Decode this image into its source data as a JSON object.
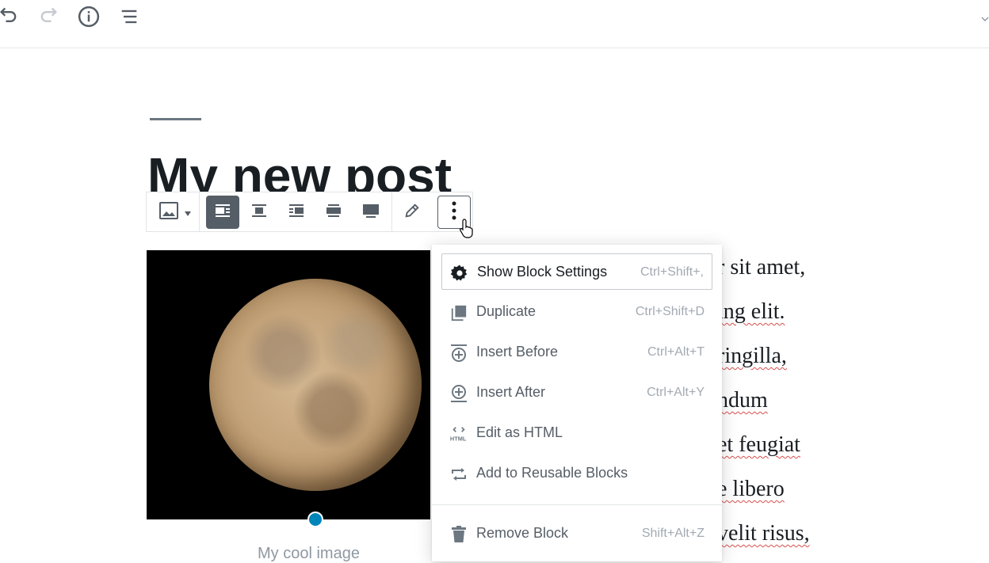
{
  "topbar": {
    "buttons": [
      {
        "icon": "undo-icon"
      },
      {
        "icon": "redo-icon"
      },
      {
        "icon": "info-icon"
      },
      {
        "icon": "list-icon"
      }
    ]
  },
  "post": {
    "title": "My new post",
    "caption": "My cool image"
  },
  "block_toolbar": {
    "buttons": [
      {
        "icon": "image-icon",
        "name": "change-block-type-button"
      },
      {
        "icon": "align-left-icon",
        "name": "align-left-button",
        "active": true
      },
      {
        "icon": "align-center-icon",
        "name": "align-center-button"
      },
      {
        "icon": "align-right-icon",
        "name": "align-right-button"
      },
      {
        "icon": "wide-width-icon",
        "name": "wide-width-button"
      },
      {
        "icon": "full-width-icon",
        "name": "full-width-button"
      },
      {
        "icon": "pencil-icon",
        "name": "edit-image-button"
      },
      {
        "icon": "more-vertical-icon",
        "name": "more-options-button"
      }
    ]
  },
  "paragraph": {
    "lines": [
      "r sit amet,",
      "ing elit.",
      "ringilla,",
      "ndum",
      "et feugiat",
      "e libero",
      "velit risus,"
    ]
  },
  "menu": {
    "items": [
      {
        "label": "Show Block Settings",
        "shortcut": "Ctrl+Shift+,",
        "icon": "gear-icon"
      },
      {
        "label": "Duplicate",
        "shortcut": "Ctrl+Shift+D",
        "icon": "duplicate-icon"
      },
      {
        "label": "Insert Before",
        "shortcut": "Ctrl+Alt+T",
        "icon": "insert-before-icon"
      },
      {
        "label": "Insert After",
        "shortcut": "Ctrl+Alt+Y",
        "icon": "insert-after-icon"
      },
      {
        "label": "Edit as HTML",
        "shortcut": "",
        "icon": "html-icon"
      },
      {
        "label": "Add to Reusable Blocks",
        "shortcut": "",
        "icon": "reusable-icon"
      },
      {
        "label": "Remove Block",
        "shortcut": "Shift+Alt+Z",
        "icon": "trash-icon"
      }
    ]
  },
  "colors": {
    "accent": "#0085ba",
    "active_button": "#555d66",
    "text": "#191e23",
    "muted": "#a2aab2"
  }
}
